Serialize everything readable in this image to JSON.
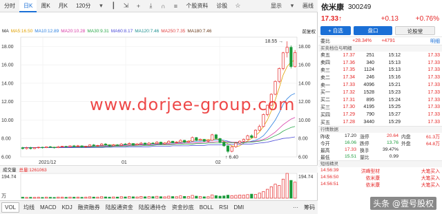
{
  "tabs": {
    "items": [
      "分时",
      "日K",
      "周K",
      "月K",
      "120分"
    ],
    "active": 1,
    "tools": [
      "个股资料",
      "诊股"
    ],
    "display": "显示",
    "draw": "画线"
  },
  "ma_legend": {
    "label": "MA",
    "items": [
      {
        "text": "MA5:16.50",
        "color": "#e0a000"
      },
      {
        "text": "MA10:12.89",
        "color": "#2a7fe0"
      },
      {
        "text": "MA20:10.28",
        "color": "#d73aa6"
      },
      {
        "text": "MA30:9.31",
        "color": "#2aa84a"
      },
      {
        "text": "MA60:8.17",
        "color": "#4a4ad8"
      },
      {
        "text": "MA120:7.46",
        "color": "#1b8f8f"
      },
      {
        "text": "MA250:7.35",
        "color": "#e04040"
      },
      {
        "text": "MA180:7.46",
        "color": "#6a3a1a"
      }
    ],
    "adjust": "前复权"
  },
  "chart_data": {
    "type": "candlestick",
    "ylim": [
      6.0,
      19.0
    ],
    "yticks": [
      "18.00",
      "16.00",
      "14.00",
      "12.00",
      "10.00",
      "8.00",
      "6.00"
    ],
    "xticks": [
      "2021/12",
      "01",
      "02"
    ],
    "high_label": "18.55",
    "low_label": "6.40",
    "candles": [
      {
        "o": 7.0,
        "c": 6.9,
        "h": 7.1,
        "l": 6.8
      },
      {
        "o": 6.9,
        "c": 7.0,
        "h": 7.1,
        "l": 6.8
      },
      {
        "o": 7.0,
        "c": 6.9,
        "h": 7.1,
        "l": 6.8
      },
      {
        "o": 6.9,
        "c": 7.0,
        "h": 7.05,
        "l": 6.85
      },
      {
        "o": 7.0,
        "c": 7.05,
        "h": 7.1,
        "l": 6.9
      },
      {
        "o": 7.05,
        "c": 7.0,
        "h": 7.1,
        "l": 6.9
      },
      {
        "o": 7.0,
        "c": 7.1,
        "h": 7.15,
        "l": 6.95
      },
      {
        "o": 7.1,
        "c": 7.05,
        "h": 7.2,
        "l": 7.0
      },
      {
        "o": 7.05,
        "c": 7.0,
        "h": 7.1,
        "l": 6.9
      },
      {
        "o": 7.0,
        "c": 7.1,
        "h": 7.2,
        "l": 6.95
      },
      {
        "o": 7.1,
        "c": 7.15,
        "h": 7.2,
        "l": 7.05
      },
      {
        "o": 7.15,
        "c": 7.1,
        "h": 7.2,
        "l": 7.0
      },
      {
        "o": 7.1,
        "c": 7.2,
        "h": 7.25,
        "l": 7.05
      },
      {
        "o": 7.2,
        "c": 7.15,
        "h": 7.3,
        "l": 7.1
      },
      {
        "o": 7.15,
        "c": 7.2,
        "h": 7.3,
        "l": 7.1
      },
      {
        "o": 7.2,
        "c": 7.1,
        "h": 7.25,
        "l": 7.0
      },
      {
        "o": 7.1,
        "c": 7.15,
        "h": 7.2,
        "l": 7.0
      },
      {
        "o": 7.15,
        "c": 7.3,
        "h": 7.35,
        "l": 7.1
      },
      {
        "o": 7.3,
        "c": 7.2,
        "h": 7.4,
        "l": 7.15
      },
      {
        "o": 7.2,
        "c": 7.25,
        "h": 7.3,
        "l": 7.1
      },
      {
        "o": 7.25,
        "c": 7.4,
        "h": 7.5,
        "l": 7.2
      },
      {
        "o": 7.4,
        "c": 7.3,
        "h": 7.5,
        "l": 7.2
      },
      {
        "o": 7.3,
        "c": 7.2,
        "h": 7.35,
        "l": 7.1
      },
      {
        "o": 7.2,
        "c": 7.3,
        "h": 7.4,
        "l": 7.15
      },
      {
        "o": 7.3,
        "c": 7.25,
        "h": 7.4,
        "l": 7.2
      },
      {
        "o": 7.25,
        "c": 7.4,
        "h": 7.5,
        "l": 7.2
      },
      {
        "o": 7.4,
        "c": 7.35,
        "h": 7.5,
        "l": 7.3
      },
      {
        "o": 7.35,
        "c": 7.45,
        "h": 7.6,
        "l": 7.3
      },
      {
        "o": 7.45,
        "c": 7.3,
        "h": 7.5,
        "l": 7.2
      },
      {
        "o": 7.3,
        "c": 7.4,
        "h": 7.5,
        "l": 7.25
      },
      {
        "o": 7.4,
        "c": 7.5,
        "h": 7.6,
        "l": 7.35
      },
      {
        "o": 7.5,
        "c": 7.35,
        "h": 7.55,
        "l": 7.3
      },
      {
        "o": 7.35,
        "c": 7.5,
        "h": 7.6,
        "l": 7.3
      },
      {
        "o": 7.5,
        "c": 7.45,
        "h": 7.6,
        "l": 7.4
      },
      {
        "o": 7.45,
        "c": 7.6,
        "h": 7.7,
        "l": 7.4
      },
      {
        "o": 7.6,
        "c": 7.4,
        "h": 7.65,
        "l": 7.35
      },
      {
        "o": 7.4,
        "c": 7.5,
        "h": 7.6,
        "l": 7.35
      },
      {
        "o": 7.5,
        "c": 7.7,
        "h": 7.8,
        "l": 7.45
      },
      {
        "o": 7.7,
        "c": 7.55,
        "h": 7.75,
        "l": 7.5
      },
      {
        "o": 7.55,
        "c": 7.6,
        "h": 7.7,
        "l": 7.5
      },
      {
        "o": 7.6,
        "c": 7.8,
        "h": 7.9,
        "l": 7.55
      },
      {
        "o": 7.8,
        "c": 7.6,
        "h": 7.85,
        "l": 7.5
      },
      {
        "o": 7.6,
        "c": 7.7,
        "h": 7.8,
        "l": 7.55
      },
      {
        "o": 7.7,
        "c": 8.1,
        "h": 8.2,
        "l": 7.65
      },
      {
        "o": 8.1,
        "c": 7.8,
        "h": 8.15,
        "l": 7.7
      },
      {
        "o": 7.8,
        "c": 7.9,
        "h": 8.0,
        "l": 7.75
      },
      {
        "o": 7.9,
        "c": 7.7,
        "h": 7.95,
        "l": 7.6
      },
      {
        "o": 7.7,
        "c": 7.8,
        "h": 7.9,
        "l": 7.6
      },
      {
        "o": 7.8,
        "c": 8.4,
        "h": 8.5,
        "l": 7.75
      },
      {
        "o": 8.4,
        "c": 8.0,
        "h": 8.5,
        "l": 7.9
      },
      {
        "o": 8.0,
        "c": 7.6,
        "h": 8.05,
        "l": 7.5
      },
      {
        "o": 7.6,
        "c": 7.2,
        "h": 7.65,
        "l": 7.1
      },
      {
        "o": 7.2,
        "c": 6.6,
        "h": 7.25,
        "l": 6.4
      },
      {
        "o": 6.6,
        "c": 7.1,
        "h": 7.2,
        "l": 6.5
      },
      {
        "o": 7.1,
        "c": 7.5,
        "h": 7.6,
        "l": 7.0
      },
      {
        "o": 7.5,
        "c": 7.7,
        "h": 7.8,
        "l": 7.4
      },
      {
        "o": 7.7,
        "c": 7.9,
        "h": 8.0,
        "l": 7.6
      },
      {
        "o": 7.9,
        "c": 8.3,
        "h": 8.4,
        "l": 7.85
      },
      {
        "o": 8.3,
        "c": 8.1,
        "h": 8.45,
        "l": 8.0
      },
      {
        "o": 8.1,
        "c": 8.9,
        "h": 9.0,
        "l": 8.05
      },
      {
        "o": 8.9,
        "c": 9.3,
        "h": 9.5,
        "l": 8.8
      },
      {
        "o": 9.3,
        "c": 10.6,
        "h": 10.7,
        "l": 9.2
      },
      {
        "o": 10.6,
        "c": 11.6,
        "h": 11.7,
        "l": 10.4
      },
      {
        "o": 11.6,
        "c": 12.8,
        "h": 12.9,
        "l": 11.5
      },
      {
        "o": 12.8,
        "c": 14.2,
        "h": 14.3,
        "l": 12.7
      },
      {
        "o": 14.2,
        "c": 15.6,
        "h": 15.7,
        "l": 14.0
      },
      {
        "o": 15.6,
        "c": 17.3,
        "h": 17.4,
        "l": 15.4
      },
      {
        "o": 17.3,
        "c": 17.9,
        "h": 18.55,
        "l": 16.8
      },
      {
        "o": 17.9,
        "c": 15.8,
        "h": 18.1,
        "l": 15.6
      },
      {
        "o": 15.8,
        "c": 17.33,
        "h": 17.6,
        "l": 15.7
      }
    ],
    "ma_lines": {
      "MA5": [
        7.0,
        7.0,
        7.0,
        7.0,
        7.0,
        7.0,
        7.0,
        7.05,
        7.05,
        7.05,
        7.1,
        7.1,
        7.1,
        7.15,
        7.15,
        7.15,
        7.15,
        7.15,
        7.2,
        7.2,
        7.25,
        7.3,
        7.3,
        7.3,
        7.3,
        7.3,
        7.35,
        7.4,
        7.4,
        7.4,
        7.4,
        7.4,
        7.45,
        7.45,
        7.5,
        7.5,
        7.5,
        7.55,
        7.6,
        7.6,
        7.65,
        7.65,
        7.7,
        7.8,
        7.85,
        7.85,
        7.85,
        7.85,
        7.9,
        7.95,
        7.9,
        7.7,
        7.4,
        7.2,
        7.1,
        7.2,
        7.5,
        7.75,
        8.0,
        8.3,
        8.7,
        9.3,
        10.0,
        11.0,
        12.2,
        13.5,
        14.9,
        15.8,
        16.3,
        16.5
      ],
      "MA10": [
        7.0,
        7.0,
        7.0,
        7.0,
        7.0,
        7.0,
        7.0,
        7.0,
        7.0,
        7.05,
        7.05,
        7.1,
        7.1,
        7.1,
        7.1,
        7.15,
        7.15,
        7.15,
        7.15,
        7.2,
        7.2,
        7.2,
        7.25,
        7.25,
        7.25,
        7.3,
        7.3,
        7.35,
        7.35,
        7.35,
        7.35,
        7.4,
        7.4,
        7.4,
        7.4,
        7.45,
        7.45,
        7.5,
        7.5,
        7.55,
        7.55,
        7.6,
        7.6,
        7.65,
        7.7,
        7.7,
        7.75,
        7.75,
        7.8,
        7.85,
        7.85,
        7.8,
        7.7,
        7.6,
        7.5,
        7.5,
        7.55,
        7.6,
        7.7,
        7.8,
        8.0,
        8.3,
        8.8,
        9.4,
        10.0,
        10.8,
        11.7,
        12.3,
        12.7,
        12.89
      ],
      "MA20": [
        7.0,
        7.0,
        7.0,
        7.0,
        7.0,
        7.0,
        7.0,
        7.0,
        7.0,
        7.0,
        7.05,
        7.05,
        7.05,
        7.05,
        7.1,
        7.1,
        7.1,
        7.1,
        7.1,
        7.15,
        7.15,
        7.15,
        7.15,
        7.2,
        7.2,
        7.2,
        7.25,
        7.25,
        7.25,
        7.3,
        7.3,
        7.3,
        7.3,
        7.35,
        7.35,
        7.35,
        7.4,
        7.4,
        7.4,
        7.45,
        7.45,
        7.5,
        7.5,
        7.5,
        7.55,
        7.55,
        7.6,
        7.6,
        7.6,
        7.65,
        7.65,
        7.65,
        7.65,
        7.6,
        7.6,
        7.6,
        7.6,
        7.65,
        7.65,
        7.7,
        7.8,
        7.9,
        8.1,
        8.4,
        8.7,
        9.1,
        9.5,
        9.8,
        10.1,
        10.28
      ],
      "MA30": [
        7.0,
        7.0,
        7.0,
        7.0,
        7.0,
        7.0,
        7.0,
        7.0,
        7.0,
        7.0,
        7.0,
        7.0,
        7.0,
        7.05,
        7.05,
        7.05,
        7.05,
        7.05,
        7.1,
        7.1,
        7.1,
        7.1,
        7.1,
        7.15,
        7.15,
        7.15,
        7.15,
        7.2,
        7.2,
        7.2,
        7.2,
        7.25,
        7.25,
        7.25,
        7.3,
        7.3,
        7.3,
        7.3,
        7.35,
        7.35,
        7.35,
        7.4,
        7.4,
        7.4,
        7.45,
        7.45,
        7.45,
        7.5,
        7.5,
        7.5,
        7.5,
        7.55,
        7.55,
        7.55,
        7.55,
        7.55,
        7.55,
        7.6,
        7.6,
        7.65,
        7.7,
        7.8,
        7.9,
        8.1,
        8.3,
        8.5,
        8.8,
        9.0,
        9.2,
        9.31
      ],
      "MA60": [
        7.0,
        7.0,
        7.0,
        7.0,
        7.0,
        7.0,
        7.0,
        7.0,
        7.0,
        7.0,
        7.0,
        7.0,
        7.0,
        7.0,
        7.0,
        7.0,
        7.0,
        7.0,
        7.0,
        7.0,
        7.0,
        7.05,
        7.05,
        7.05,
        7.05,
        7.05,
        7.05,
        7.1,
        7.1,
        7.1,
        7.1,
        7.1,
        7.1,
        7.15,
        7.15,
        7.15,
        7.15,
        7.15,
        7.2,
        7.2,
        7.2,
        7.2,
        7.2,
        7.25,
        7.25,
        7.25,
        7.25,
        7.3,
        7.3,
        7.3,
        7.3,
        7.3,
        7.35,
        7.35,
        7.35,
        7.35,
        7.4,
        7.4,
        7.4,
        7.45,
        7.5,
        7.55,
        7.6,
        7.7,
        7.8,
        7.9,
        8.0,
        8.05,
        8.1,
        8.17
      ]
    },
    "volume_ylim": [
      0,
      194.74
    ],
    "volume_ticks": [
      "194.74",
      "万"
    ],
    "volumes": [
      8,
      6,
      7,
      6,
      7,
      6,
      8,
      7,
      6,
      9,
      8,
      7,
      9,
      8,
      9,
      7,
      8,
      11,
      9,
      8,
      12,
      10,
      8,
      10,
      9,
      12,
      10,
      13,
      11,
      10,
      14,
      11,
      13,
      12,
      15,
      12,
      11,
      16,
      13,
      12,
      18,
      14,
      13,
      22,
      16,
      13,
      11,
      12,
      26,
      20,
      16,
      18,
      24,
      20,
      22,
      25,
      24,
      28,
      32,
      30,
      40,
      52,
      70,
      90,
      110,
      100,
      150,
      194.74,
      140,
      126.11
    ],
    "total_volume": "总量:1261063"
  },
  "vol_legend": {
    "label": "成交量",
    "total": "总量:1261063"
  },
  "indicators": {
    "items": [
      "VOL",
      "均线",
      "MACD",
      "KDJ",
      "融资融券",
      "陆股通资金",
      "陆股通持仓",
      "资金抄底",
      "BOLL",
      "RSI",
      "DMI"
    ],
    "active": 0,
    "more": "···",
    "config": "筹码"
  },
  "quote": {
    "name": "依米康",
    "code": "300249",
    "price": "17.33↑",
    "change": "+0.13",
    "pct": "+0.76%",
    "btn_add": "+ 自选",
    "btn_pankou": "盘口",
    "btn_lungu": "论股堂",
    "weibi_label": "委比",
    "weibi_value": "+28.34%",
    "weicha_value": "+4791",
    "detail_label": "明细",
    "book_title": "买卖档位与明细",
    "book": [
      {
        "lab": "卖五",
        "pr": "17.37",
        "vo": "251",
        "tm": "15:12",
        "tp": "17.33"
      },
      {
        "lab": "卖四",
        "pr": "17.36",
        "vo": "340",
        "tm": "15:13",
        "tp": "17.33"
      },
      {
        "lab": "卖三",
        "pr": "17.35",
        "vo": "1124",
        "tm": "15:13",
        "tp": "17.33"
      },
      {
        "lab": "卖二",
        "pr": "17.34",
        "vo": "246",
        "tm": "15:16",
        "tp": "17.33"
      },
      {
        "lab": "卖一",
        "pr": "17.33",
        "vo": "4096",
        "tm": "15:21",
        "tp": "17.33"
      },
      {
        "lab": "买一",
        "pr": "17.32",
        "vo": "1528",
        "tm": "15:23",
        "tp": "17.33"
      },
      {
        "lab": "买二",
        "pr": "17.31",
        "vo": "895",
        "tm": "15:24",
        "tp": "17.33"
      },
      {
        "lab": "买三",
        "pr": "17.30",
        "vo": "4195",
        "tm": "15:25",
        "tp": "17.33"
      },
      {
        "lab": "买四",
        "pr": "17.29",
        "vo": "790",
        "tm": "15:27",
        "tp": "17.33"
      },
      {
        "lab": "买五",
        "pr": "17.28",
        "vo": "3440",
        "tm": "15:29",
        "tp": "17.33"
      }
    ],
    "stats_title": "行情数据",
    "stats": [
      {
        "k": "昨收",
        "v": "17.20",
        "vc": "blk",
        "k2": "涨停",
        "v2": "20.64",
        "v2c": "red",
        "k3": "内盘",
        "v3": "61.3万"
      },
      {
        "k": "今开",
        "v": "16.06",
        "vc": "green",
        "k2": "跌停",
        "v2": "13.76",
        "v2c": "green",
        "k3": "外盘",
        "v3": "64.8万"
      },
      {
        "k": "最高",
        "v": "17.33",
        "vc": "red",
        "k2": "换手",
        "v2": "39.47%",
        "v2c": "blk",
        "k3": "",
        "v3": ""
      },
      {
        "k": "最低",
        "v": "15.51",
        "vc": "green",
        "k2": "量比",
        "v2": "0.99",
        "v2c": "blk",
        "k3": "",
        "v3": ""
      }
    ],
    "sprite_title": "短线精灵",
    "sprites": [
      {
        "t": "14:56:39",
        "n": "洪峰型材",
        "e": "大笔买入"
      },
      {
        "t": "14:56:50",
        "n": "依米康",
        "e": "大笔买入"
      },
      {
        "t": "14:56:51",
        "n": "依米康",
        "e": "大笔买入"
      }
    ]
  },
  "watermark": "www.dorjee-group.com",
  "credit": "头条 @壹号股权"
}
